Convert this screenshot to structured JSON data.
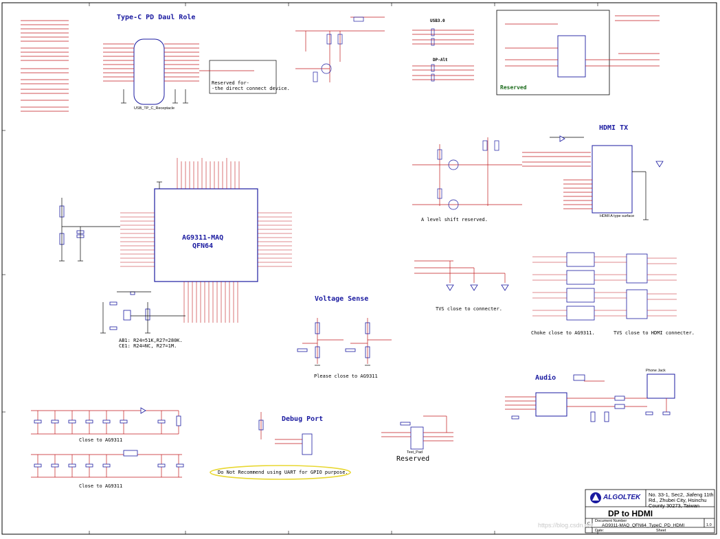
{
  "sections": {
    "typec": "Type-C PD Daul Role",
    "usb3": "USB3.0",
    "dpalt": "DP-Alt",
    "hdmi_tx": "HDMI TX",
    "voltage_sense": "Voltage Sense",
    "audio": "Audio",
    "debug_port": "Debug Port",
    "reserved_top": "Reserved",
    "reserved_bottom": "Reserved"
  },
  "chip": {
    "name": "AG9311-MAQ",
    "package": "QFN64"
  },
  "notes": {
    "reserved_direct_1": "Reserved for-",
    "reserved_direct_2": "-the direct connect device.",
    "level_shift": "A level shift reserved.",
    "tvs_connecter": "TVS close to connecter.",
    "choke": "Choke close to AG9311.",
    "tvs_hdmi": "TVS close to HDMI connecter.",
    "place_close": "Please close to AG9311",
    "close1": "Close to AG9311",
    "close2": "Close to AG9311",
    "uart_warning": "Do Not Recommend using UART for GPIO purpose.",
    "ab1": "AB1: R24=51K,R27=280K.",
    "ce1": "CE1: R24=NC, R27=1M."
  },
  "connectors": {
    "typec_receptacle": "USB_TP_C_Receptacle",
    "hdmi_connector": "HDMI A type surface",
    "phone_jack": "Phone Jack",
    "test_pad": "Test_Pad"
  },
  "title_block": {
    "logo": "ALGOLTEK",
    "address_1": "No. 33-1, Sec2, Jiafeng 11th",
    "address_2": "Rd., Zhubei City, Hsinchu",
    "address_3": "County 30273, Taiwan",
    "title": "DP to HDMI",
    "doc_number": "AG9311-MAQ_QFN64_TypeC_PD_HDMI",
    "rev": "1.0",
    "size": "C",
    "date_label": "Date:",
    "sheet_label": "Sheet",
    "doc_label": "Document Number"
  },
  "watermark": "https://blog.csdn.net"
}
